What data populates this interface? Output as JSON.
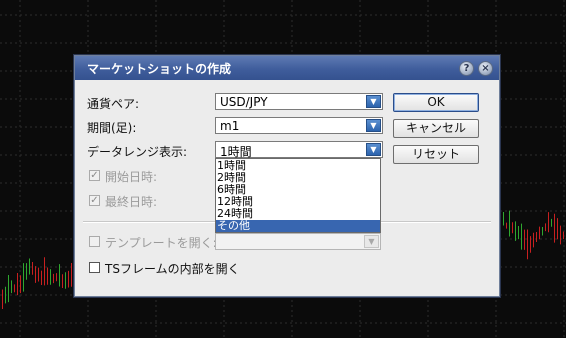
{
  "dialog": {
    "title": "マーケットショットの作成",
    "help_glyph": "?",
    "close_glyph": "×"
  },
  "form": {
    "pair_label": "通貨ペア:",
    "pair_value": "USD/JPY",
    "period_label": "期間(足):",
    "period_value": "m1",
    "range_label": "データレンジ表示:",
    "range_value": "1時間",
    "range_options": [
      "1時間",
      "2時間",
      "6時間",
      "12時間",
      "24時間",
      "その他"
    ],
    "range_selected_index": 5,
    "start_label": "開始日時:",
    "end_label": "最終日時:",
    "template_label": "テンプレートを開く:",
    "ts_label": "TSフレームの内部を開く"
  },
  "checkboxes": {
    "start_checked": true,
    "end_checked": true,
    "template_checked": false,
    "ts_checked": false
  },
  "buttons": {
    "ok": "OK",
    "cancel": "キャンセル",
    "reset": "リセット"
  },
  "icons": {
    "dropdown_arrow": "chevron-down-icon",
    "check": "checkmark-icon"
  },
  "colors": {
    "title_bar": "#4565a3",
    "selection": "#3866b0",
    "candle_up": "#2fa82f",
    "candle_down": "#c82020"
  }
}
